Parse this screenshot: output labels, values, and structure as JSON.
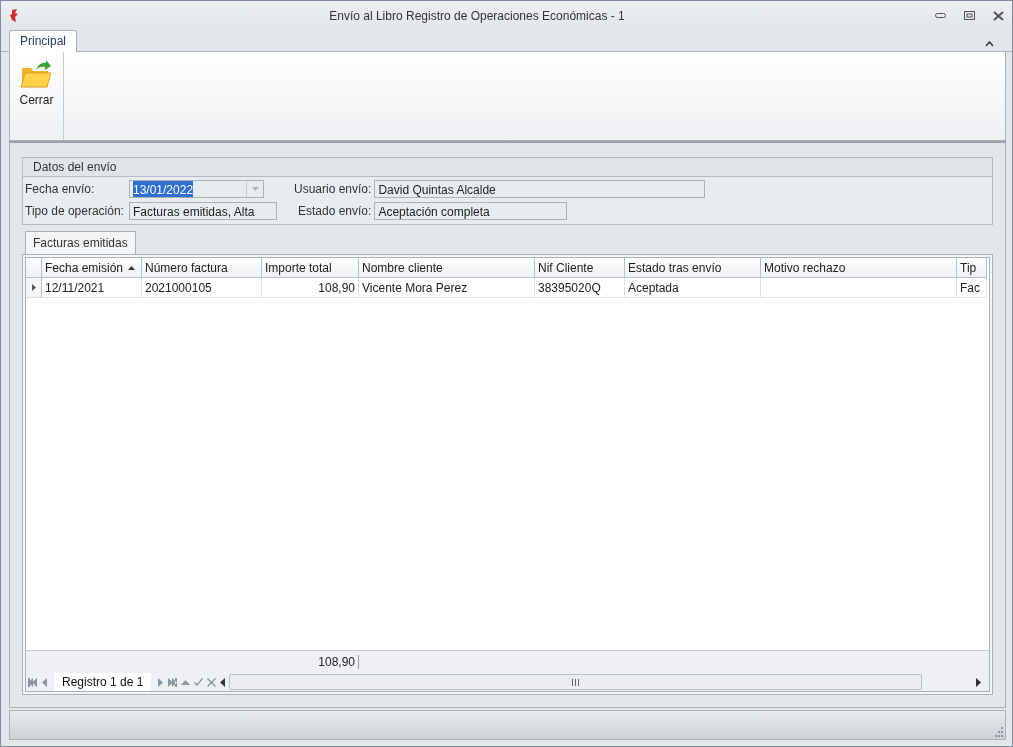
{
  "window": {
    "title": "Envío al Libro Registro de Operaciones Económicas - 1"
  },
  "ribbon": {
    "tabs": [
      {
        "label": "Principal",
        "selected": true
      }
    ],
    "buttons": [
      {
        "label": "Cerrar"
      }
    ]
  },
  "group": {
    "title": "Datos del envío",
    "fields": [
      {
        "label": "Fecha envío:",
        "value": "13/01/2022",
        "kind": "combo",
        "highlighted": true
      },
      {
        "label": "Usuario envío:",
        "value": "David Quintas Alcalde",
        "kind": "text"
      },
      {
        "label": "Tipo de operación:",
        "value": "Facturas emitidas, Alta",
        "kind": "text"
      },
      {
        "label": "Estado envío:",
        "value": "Aceptación completa",
        "kind": "text"
      }
    ]
  },
  "grid_tabs": [
    {
      "label": "Facturas emitidas",
      "selected": true
    }
  ],
  "table": {
    "columns": [
      {
        "label": "Fecha emisión",
        "sorted": true
      },
      {
        "label": "Número factura",
        "sorted": false
      },
      {
        "label": "Importe total",
        "sorted": false
      },
      {
        "label": "Nombre cliente",
        "sorted": false
      },
      {
        "label": "Nif Cliente",
        "sorted": false
      },
      {
        "label": "Estado tras envío",
        "sorted": false
      },
      {
        "label": "Motivo rechazo",
        "sorted": false
      },
      {
        "label": "Tip",
        "sorted": false
      }
    ],
    "rows": [
      {
        "focused": true,
        "cells": [
          "12/11/2021",
          "2021000105",
          "108,90",
          "Vicente Mora Perez",
          "38395020Q",
          "Aceptada",
          "",
          "Fac"
        ]
      }
    ],
    "summary": "108,90"
  },
  "navigator": {
    "text": "Registro 1 de 1"
  }
}
